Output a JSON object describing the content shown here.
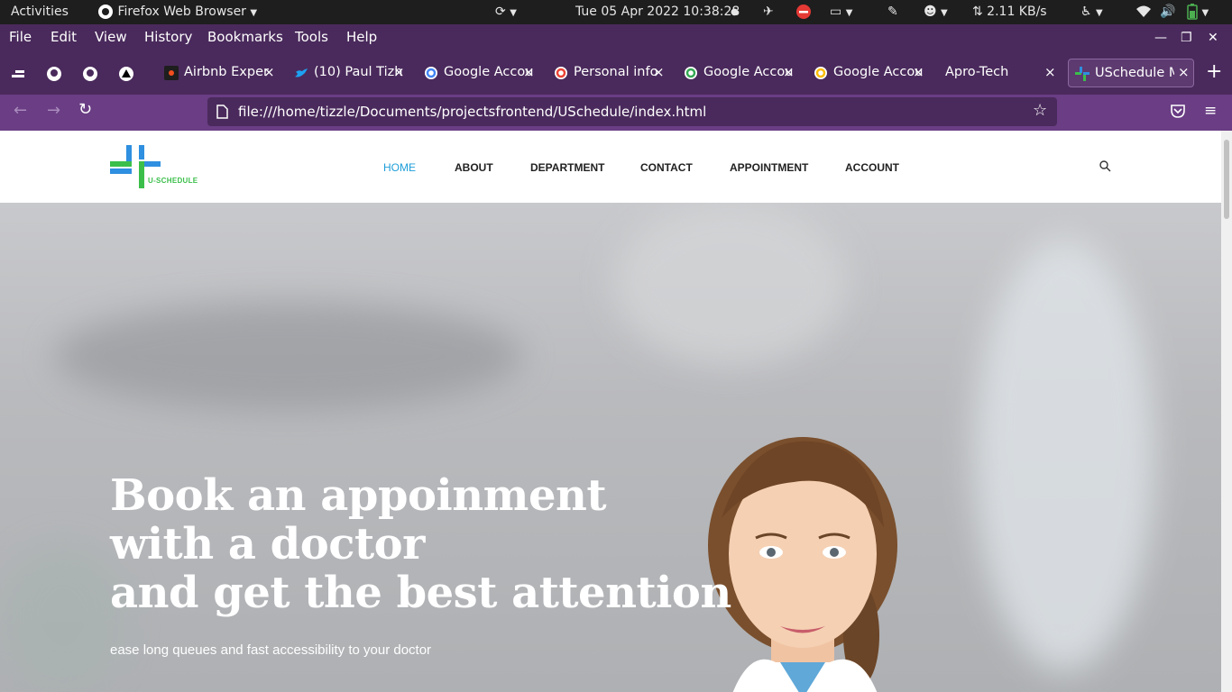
{
  "system_bar": {
    "activities": "Activities",
    "app_menu": "Firefox Web Browser",
    "clock": "Tue 05 Apr 2022 10:38:28",
    "net_speed": "⇅ 2.11 KB/s"
  },
  "menubar": {
    "items": [
      "File",
      "Edit",
      "View",
      "History",
      "Bookmarks",
      "Tools",
      "Help"
    ]
  },
  "tabs": [
    {
      "label": "Airbnb Exper"
    },
    {
      "label": "(10) Paul Tizh"
    },
    {
      "label": "Google Accou"
    },
    {
      "label": "Personal info"
    },
    {
      "label": "Google Accou"
    },
    {
      "label": "Google Accou"
    },
    {
      "label": "Apro-Tech"
    },
    {
      "label": "USchedule M"
    }
  ],
  "url": "file:///home/tizzle/Documents/projectsfrontend/USchedule/index.html",
  "site": {
    "logo_text": "U-SCHEDULE",
    "nav": [
      "HOME",
      "ABOUT",
      "DEPARTMENT",
      "CONTACT",
      "APPOINTMENT",
      "ACCOUNT"
    ],
    "hero_line1": "Book an appoinment",
    "hero_line2": "with a doctor",
    "hero_line3": "and get the best attention",
    "hero_sub": "ease long queues and fast accessibility to your doctor"
  },
  "colors": {
    "browser_chrome": "#4a2a5c",
    "nav_active": "#1e9ed8",
    "logo_green": "#3bbf4a",
    "logo_blue": "#2f8fe0"
  },
  "icons": [
    "refresh-icon",
    "clock-dot",
    "no-entry-icon",
    "screen-icon",
    "pen-icon",
    "emoji-icon",
    "accessibility-icon",
    "wifi-icon",
    "volume-icon",
    "battery-icon",
    "github-icon",
    "search-icon",
    "star-icon",
    "pocket-icon",
    "hamburger-icon"
  ]
}
